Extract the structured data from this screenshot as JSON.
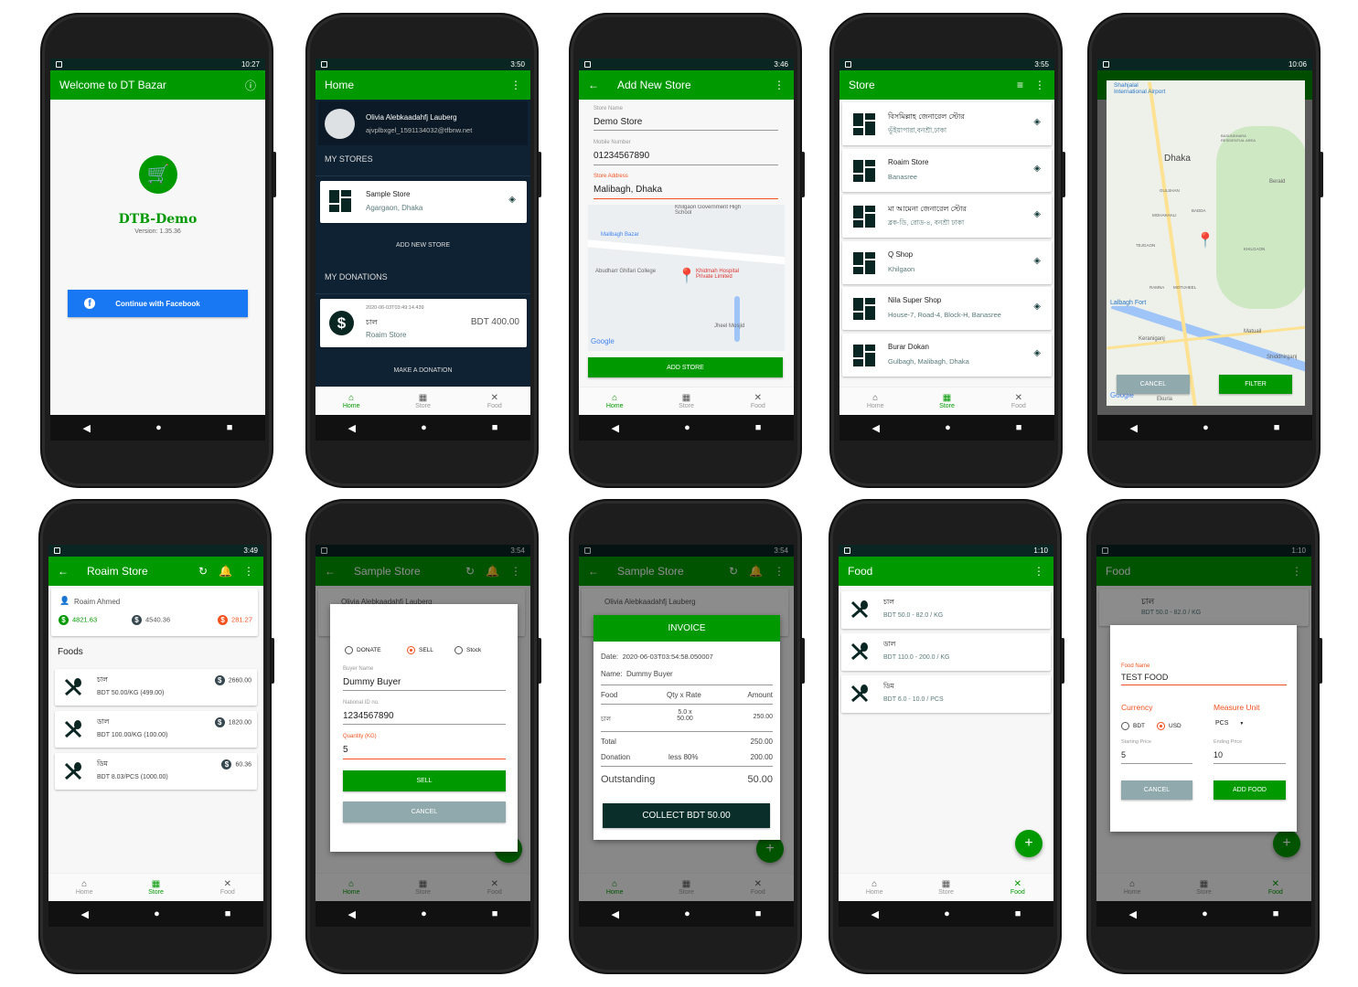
{
  "colors": {
    "primary": "#009900",
    "dark": "#0f2233",
    "accent": "#f4511e",
    "facebook": "#1877f2",
    "cancel": "#90a9ad"
  },
  "bottom_nav": [
    "Home",
    "Store",
    "Food"
  ],
  "welcome": {
    "time": "10:27",
    "title": "Welcome to DT Bazar",
    "app_name": "DTB-Demo",
    "version": "Version: 1.35.36",
    "facebook_button": "Continue with Facebook"
  },
  "home": {
    "time": "3:50",
    "title": "Home",
    "user_name": "Olivia Alebkaadahfj Lauberg",
    "email": "ajvplbxgel_1591134032@tfbnw.net",
    "my_stores": "MY STORES",
    "store": {
      "name": "Sample Store",
      "address": "Agargaon, Dhaka"
    },
    "add_store": "ADD NEW STORE",
    "my_donations": "MY DONATIONS",
    "donation": {
      "date": "2020-06-03T03:49:14.439",
      "item": "চাল",
      "store": "Roaim Store",
      "amount": "BDT 400.00"
    },
    "make_donation": "MAKE A DONATION"
  },
  "add_store": {
    "time": "3:46",
    "title": "Add New Store",
    "fields": [
      {
        "label": "Store Name",
        "value": "Demo Store"
      },
      {
        "label": "Mobile Number",
        "value": "01234567890"
      },
      {
        "label": "Store Address",
        "value": "Malibagh, Dhaka"
      }
    ],
    "map_labels": [
      "Khilgaon Government High School",
      "Malibagh Bazar",
      "Abudharr Ghifari College",
      "Khidmah Hospital Private Limited",
      "Jheel Mosjid",
      "Google"
    ],
    "button": "ADD STORE"
  },
  "store_list": {
    "time": "3:55",
    "title": "Store",
    "stores": [
      {
        "name": "বিসমিল্লাহ জেনারেল স্টোর",
        "address": "ভূঁইয়াপারা,বনশ্রী,ঢাকা"
      },
      {
        "name": "Roaim Store",
        "address": "Banasree"
      },
      {
        "name": "মা আমেনা জেনারেল স্টোর",
        "address": "ব্লক-ডি, রোড-৪, বনশ্রী ঢাকা"
      },
      {
        "name": "Q Shop",
        "address": "Khilgaon"
      },
      {
        "name": "Nila Super Shop",
        "address": "House-7, Road-4, Block-H, Banasree"
      },
      {
        "name": "Burar Dokan",
        "address": "Gulbagh, Malibagh, Dhaka"
      }
    ]
  },
  "map_filter": {
    "time": "10:06",
    "labels": [
      "Shahjalal International Airport",
      "Dhaka",
      "BASUNDHARA RESIDENTIAL AREA",
      "GULSHAN",
      "BADDA",
      "MOHAKHALI",
      "Beraid",
      "TEJGAON",
      "KHILGAON",
      "RAMNA",
      "MOTIJHEEL",
      "Lalbagh Fort",
      "Keraniganj",
      "Matuail",
      "Shiddhirganj",
      "Ekuria",
      "Google"
    ],
    "cancel": "CANCEL",
    "filter": "FILTER"
  },
  "roaim_store": {
    "time": "3:49",
    "title": "Roaim Store",
    "owner": "Roaim Ahmed",
    "balances": [
      "4821.63",
      "4540.36",
      "281.27"
    ],
    "foods_heading": "Foods",
    "foods": [
      {
        "name": "চাল",
        "price": "BDT 50.00/KG (499.00)",
        "total": "2660.00"
      },
      {
        "name": "ডাল",
        "price": "BDT 100.00/KG (100.00)",
        "total": "1820.00"
      },
      {
        "name": "ডিম",
        "price": "BDT 8.03/PCS (1000.00)",
        "total": "60.36"
      }
    ]
  },
  "sell_dialog": {
    "time": "3:54",
    "title": "Sample Store",
    "bg_user": "Olivia Alebkaadahfj Lauberg",
    "options": [
      "DONATE",
      "SELL",
      "Stock"
    ],
    "selected": "SELL",
    "fields": [
      {
        "label": "Buyer Name",
        "value": "Dummy Buyer"
      },
      {
        "label": "National ID no.",
        "value": "1234567890"
      },
      {
        "label": "Quantity (KG)",
        "value": "5"
      }
    ],
    "sell": "SELL",
    "cancel": "CANCEL"
  },
  "invoice": {
    "time": "3:54",
    "title": "Sample Store",
    "bg_user": "Olivia Alebkaadahfj Lauberg",
    "header": "INVOICE",
    "date_label": "Date:",
    "date": "2020-06-03T03:54:58.050007",
    "name_label": "Name:",
    "name": "Dummy Buyer",
    "columns": [
      "Food",
      "Qty x Rate",
      "Amount"
    ],
    "row": {
      "food": "চাল",
      "qty": "5.0 x",
      "rate": "50.00",
      "amount": "250.00"
    },
    "total_label": "Total",
    "total": "250.00",
    "donation_label": "Donation",
    "donation_note": "less 80%",
    "donation": "200.00",
    "outstanding_label": "Outstanding",
    "outstanding": "50.00",
    "collect": "COLLECT BDT 50.00"
  },
  "food_list": {
    "time": "1:10",
    "title": "Food",
    "foods": [
      {
        "name": "চাল",
        "price": "BDT 50.0 - 82.0 / KG"
      },
      {
        "name": "ডাল",
        "price": "BDT 110.0 - 200.0 / KG"
      },
      {
        "name": "ডিম",
        "price": "BDT 6.0 - 10.0 / PCS"
      }
    ]
  },
  "add_food": {
    "time": "1:10",
    "title": "Food",
    "bg_food": {
      "name": "চাল",
      "price": "BDT 50.0 - 82.0 / KG"
    },
    "food_name_label": "Food Name",
    "food_name": "TEST FOOD",
    "currency_label": "Currency",
    "currencies": [
      "BDT",
      "USD"
    ],
    "selected_currency": "USD",
    "measure_label": "Measure Unit",
    "measure": "PCS",
    "start_label": "Starting Price",
    "start": "5",
    "end_label": "Ending Price",
    "end": "10",
    "cancel": "CANCEL",
    "add": "ADD FOOD"
  }
}
